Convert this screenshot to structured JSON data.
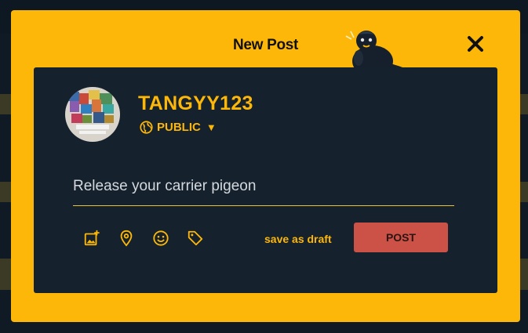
{
  "dialog": {
    "title": "New Post",
    "close_label": "✕"
  },
  "user": {
    "username": "TANGYY123",
    "privacy": "PUBLIC",
    "privacy_caret": "▼"
  },
  "composer": {
    "placeholder": "Release your carrier pigeon",
    "value": ""
  },
  "toolbar": {
    "icons": [
      "add-image-icon",
      "location-pin-icon",
      "emoji-icon",
      "tag-icon"
    ],
    "draft_label": "save as draft",
    "post_label": "POST"
  },
  "colors": {
    "accent": "#fdb709",
    "card": "#15212d",
    "post_button": "#cc5147",
    "backdrop": "#0f1a24"
  }
}
